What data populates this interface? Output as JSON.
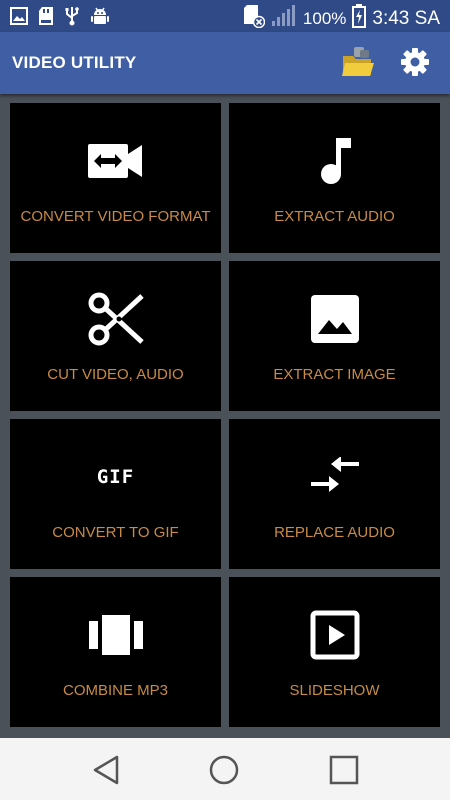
{
  "status_bar": {
    "battery_percent": "100%",
    "time": "3:43 SA",
    "left_icons": [
      "image-icon",
      "sd-card-icon",
      "usb-icon",
      "android-debug-icon"
    ],
    "right_icons": [
      "sim-error-icon",
      "signal-icon",
      "battery-charging-icon"
    ]
  },
  "app_bar": {
    "title": "VIDEO UTILITY",
    "actions": [
      "folder-icon",
      "settings-icon"
    ]
  },
  "tiles": [
    {
      "label": "CONVERT VIDEO FORMAT",
      "icon": "convert-video-icon"
    },
    {
      "label": "EXTRACT AUDIO",
      "icon": "music-note-icon"
    },
    {
      "label": "CUT VIDEO, AUDIO",
      "icon": "scissors-icon"
    },
    {
      "label": "EXTRACT IMAGE",
      "icon": "image-icon"
    },
    {
      "label": "CONVERT TO GIF",
      "icon": "gif-icon",
      "icon_text": "GIF"
    },
    {
      "label": "REPLACE AUDIO",
      "icon": "swap-arrows-icon"
    },
    {
      "label": "COMBINE MP3",
      "icon": "carousel-icon"
    },
    {
      "label": "SLIDESHOW",
      "icon": "slideshow-icon"
    }
  ],
  "nav_bar": [
    "back-icon",
    "home-icon",
    "recents-icon"
  ],
  "colors": {
    "status_bar": "#2f4a86",
    "app_bar": "#3f5ea3",
    "background": "#4a5158",
    "tile": "#000000",
    "label": "#c98a45"
  }
}
